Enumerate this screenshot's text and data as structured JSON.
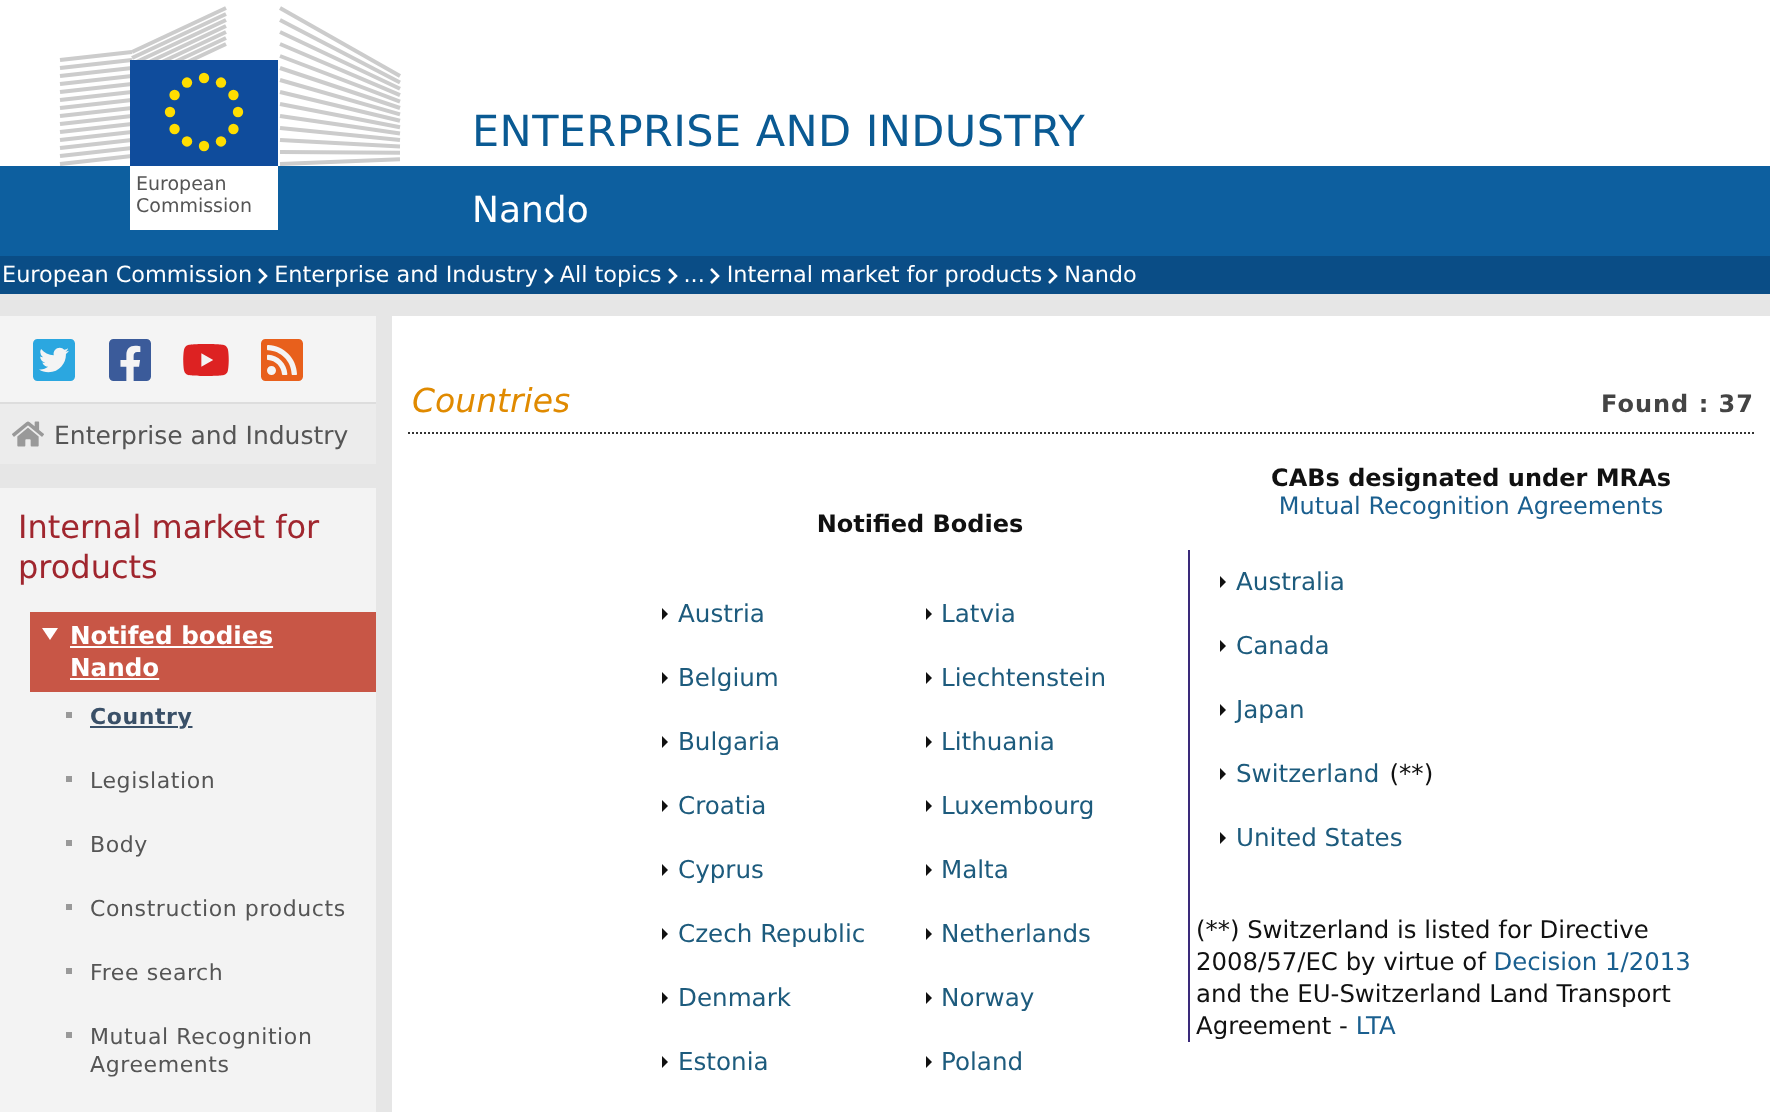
{
  "header": {
    "logo_text": "European Commission",
    "title": "ENTERPRISE AND INDUSTRY",
    "subtitle": "Nando"
  },
  "breadcrumb": [
    "European Commission",
    "Enterprise and Industry",
    "All topics",
    "...",
    "Internal market for products",
    "Nando"
  ],
  "sidebar": {
    "home_link": "Enterprise and Industry",
    "section_title": "Internal market for products",
    "nav": [
      {
        "label": "Notifed bodies Nando",
        "selected": true,
        "children": [
          {
            "label": "Country",
            "selected": true
          },
          {
            "label": "Legislation",
            "selected": false
          },
          {
            "label": "Body",
            "selected": false
          },
          {
            "label": "Construction products",
            "selected": false
          },
          {
            "label": "Free search",
            "selected": false
          },
          {
            "label": "Mutual Recognition Agreements",
            "selected": false
          }
        ]
      }
    ]
  },
  "main": {
    "heading": "Countries",
    "found": "Found : 37",
    "notified_bodies": {
      "title": "Notified Bodies",
      "columns": [
        [
          "Austria",
          "Belgium",
          "Bulgaria",
          "Croatia",
          "Cyprus",
          "Czech Republic",
          "Denmark",
          "Estonia"
        ],
        [
          "Latvia",
          "Liechtenstein",
          "Lithuania",
          "Luxembourg",
          "Malta",
          "Netherlands",
          "Norway",
          "Poland"
        ]
      ]
    },
    "mra": {
      "title": "CABs designated under MRAs",
      "subtitle_link": "Mutual Recognition Agreements",
      "countries": [
        {
          "name": "Australia"
        },
        {
          "name": "Canada"
        },
        {
          "name": "Japan"
        },
        {
          "name": "Switzerland",
          "note": "(**)"
        },
        {
          "name": "United States"
        }
      ],
      "footnote": [
        {
          "kind": "text",
          "text": "(**) Switzerland is listed for Directive 2008/57/EC by virtue of "
        },
        {
          "kind": "link",
          "text": "Decision 1/2013"
        },
        {
          "kind": "text",
          "text": " and the EU-Switzerland Land Transport Agreement - "
        },
        {
          "kind": "link",
          "text": "LTA"
        }
      ]
    }
  }
}
